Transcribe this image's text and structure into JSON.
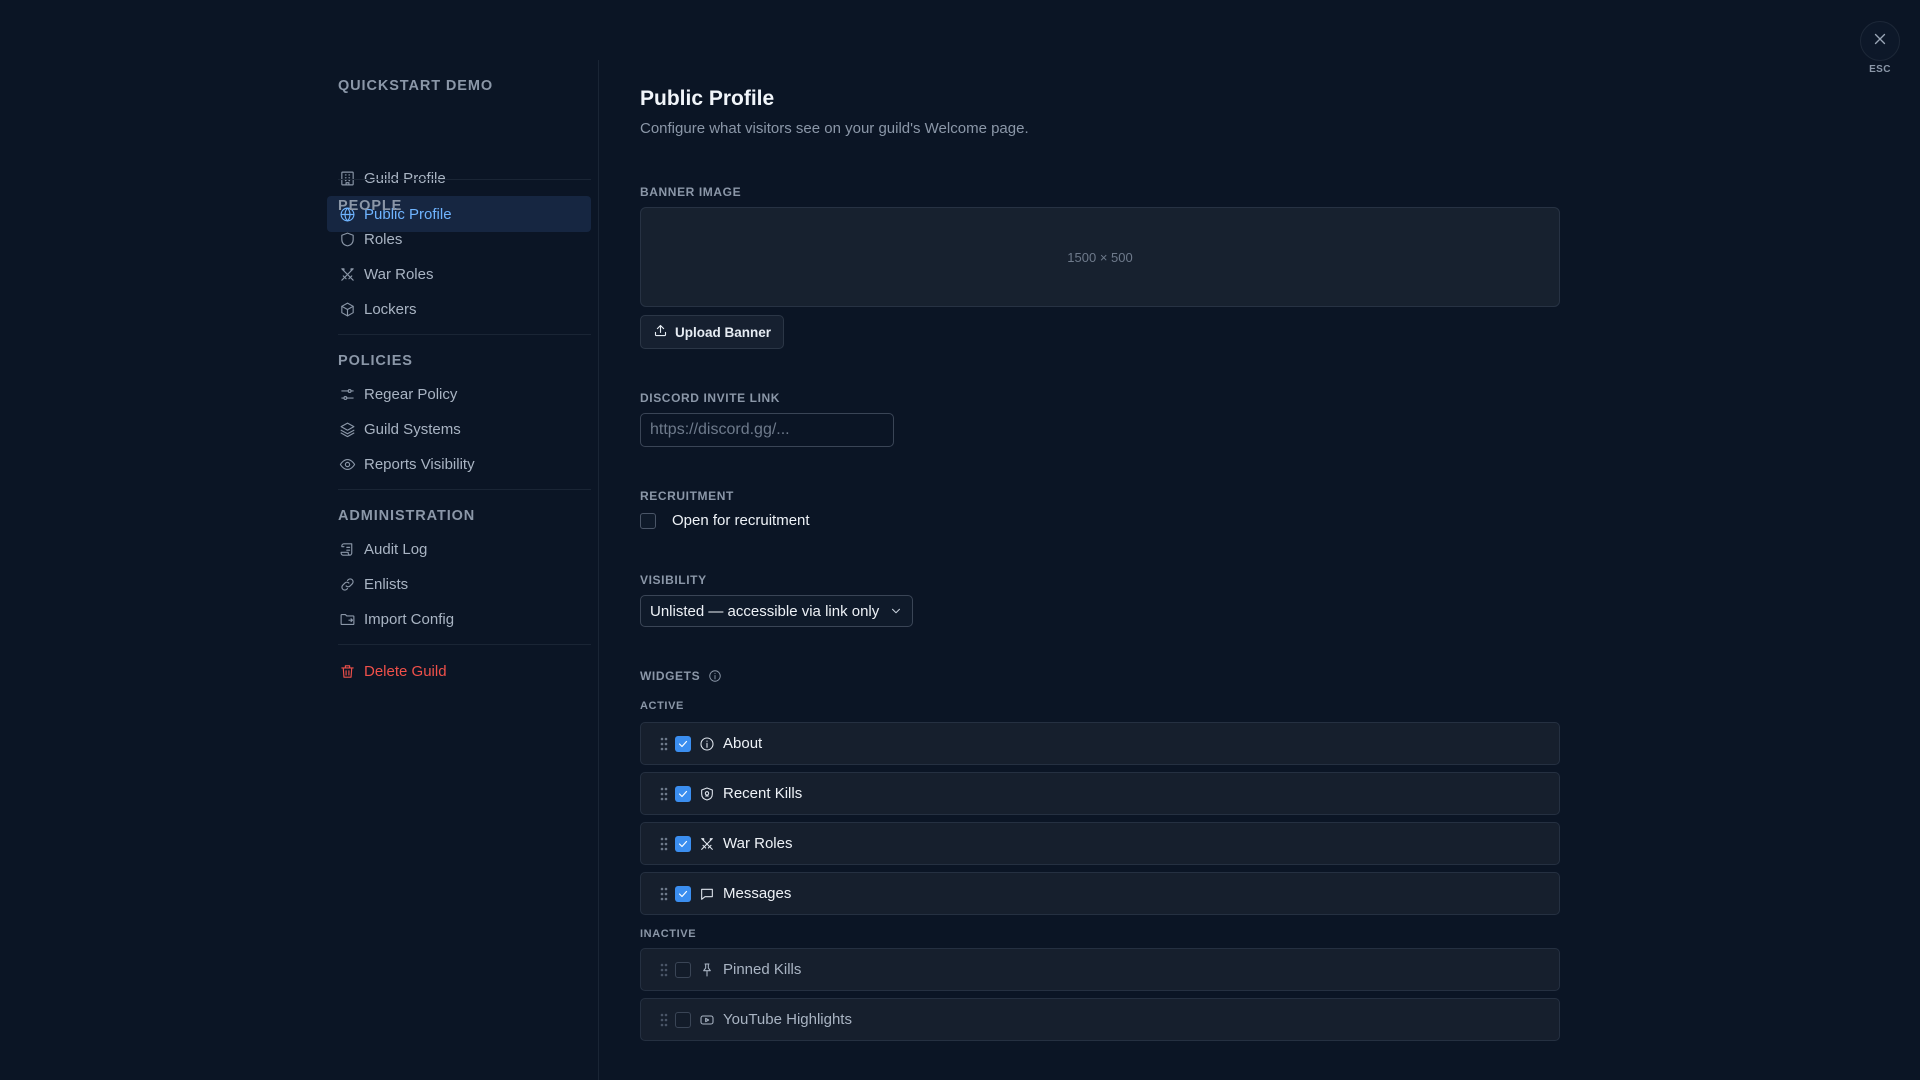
{
  "sidebar": {
    "sections": [
      {
        "title": "QUICKSTART DEMO",
        "items": [
          {
            "label": "Guild Profile",
            "icon": "building-icon"
          },
          {
            "label": "Public Profile",
            "icon": "globe-icon",
            "active": true
          }
        ]
      },
      {
        "title": "PEOPLE",
        "items": [
          {
            "label": "Roles",
            "icon": "shield-icon"
          },
          {
            "label": "War Roles",
            "icon": "crossed-swords-icon"
          },
          {
            "label": "Lockers",
            "icon": "box-icon"
          }
        ]
      },
      {
        "title": "POLICIES",
        "items": [
          {
            "label": "Regear Policy",
            "icon": "sliders-icon"
          },
          {
            "label": "Guild Systems",
            "icon": "layers-icon"
          },
          {
            "label": "Reports Visibility",
            "icon": "eye-icon"
          }
        ]
      },
      {
        "title": "ADMINISTRATION",
        "items": [
          {
            "label": "Audit Log",
            "icon": "scroll-icon"
          },
          {
            "label": "Enlists",
            "icon": "link-icon"
          },
          {
            "label": "Import Config",
            "icon": "folder-icon"
          }
        ]
      }
    ],
    "delete_label": "Delete Guild"
  },
  "close": {
    "esc_label": "ESC"
  },
  "page": {
    "title": "Public Profile",
    "subtitle": "Configure what visitors see on your guild's Welcome page."
  },
  "banner": {
    "label": "BANNER IMAGE",
    "size_hint": "1500 × 500",
    "upload_label": "Upload Banner"
  },
  "invite": {
    "label": "DISCORD INVITE LINK",
    "placeholder": "https://discord.gg/...",
    "value": ""
  },
  "recruitment": {
    "label": "RECRUITMENT",
    "checkbox_label": "Open for recruitment",
    "checked": false
  },
  "visibility": {
    "label": "VISIBILITY",
    "selected": "Unlisted — accessible via link only"
  },
  "widgets": {
    "label": "WIDGETS",
    "active_label": "ACTIVE",
    "inactive_label": "INACTIVE",
    "active": [
      {
        "name": "About",
        "icon": "info-circle-icon",
        "enabled": true
      },
      {
        "name": "Recent Kills",
        "icon": "skull-shield-icon",
        "enabled": true
      },
      {
        "name": "War Roles",
        "icon": "crossed-swords-icon",
        "enabled": true
      },
      {
        "name": "Messages",
        "icon": "message-square-icon",
        "enabled": true
      }
    ],
    "inactive": [
      {
        "name": "Pinned Kills",
        "icon": "pin-icon",
        "enabled": false
      },
      {
        "name": "YouTube Highlights",
        "icon": "youtube-icon",
        "enabled": false
      }
    ]
  },
  "colors": {
    "background": "#0b1525",
    "accent": "#3b8ef0",
    "active_nav_text": "#6fb4ff",
    "danger": "#f0504a"
  }
}
